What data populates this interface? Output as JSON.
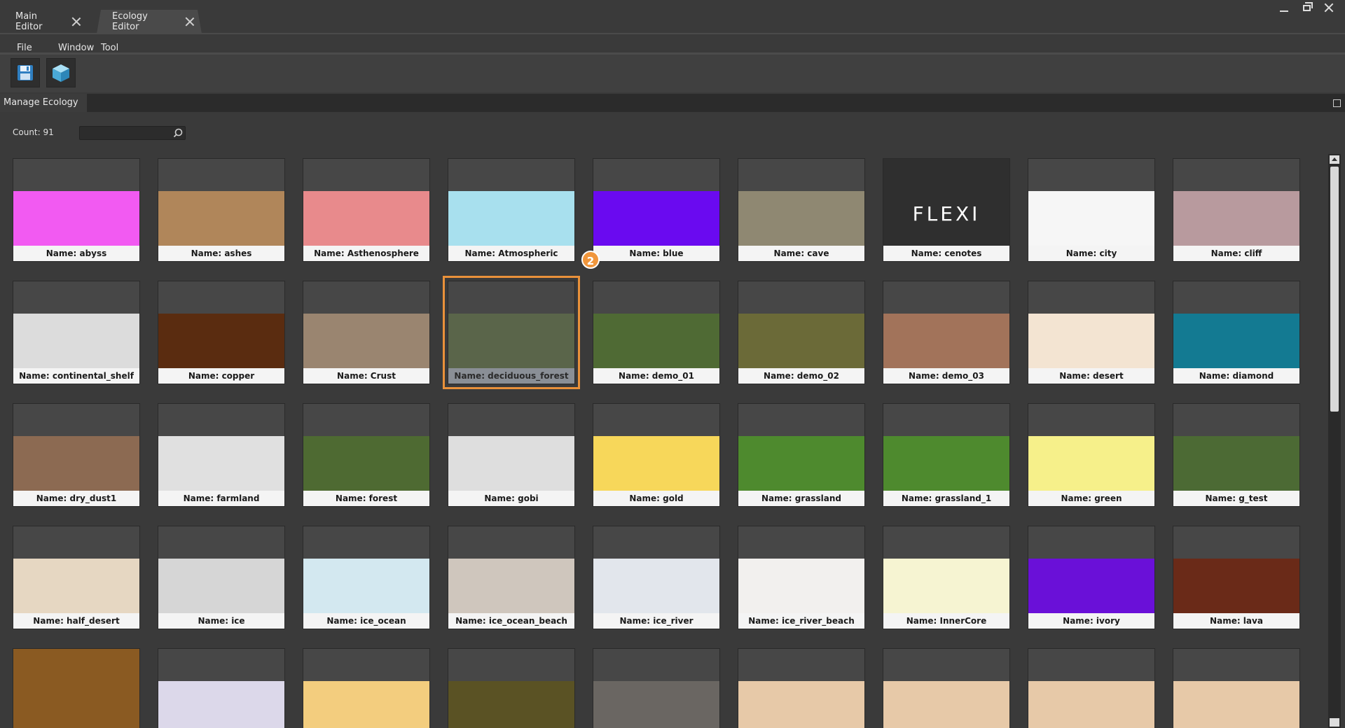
{
  "tabs": [
    {
      "label": "Main Editor"
    },
    {
      "label": "Ecology Editor"
    }
  ],
  "menu": {
    "file": "File",
    "window": "Window",
    "tool": "Tool"
  },
  "toolbar": {
    "save_icon": "save-disk-icon",
    "cube_icon": "cube-icon"
  },
  "panel": {
    "title": "Manage Ecology",
    "count_label": "Count: 91",
    "search_value": ""
  },
  "annotation": {
    "badge": "2"
  },
  "cards": [
    {
      "name": "Name: abyss",
      "color": "#f25af2",
      "sky": true
    },
    {
      "name": "Name: ashes",
      "color": "#b0865a",
      "sky": true
    },
    {
      "name": "Name: Asthenosphere",
      "color": "#e88a8c",
      "sky": true
    },
    {
      "name": "Name: Atmospheric",
      "color": "#a8e0ee",
      "sky": true
    },
    {
      "name": "Name: blue",
      "color": "#6a0af0",
      "sky": true
    },
    {
      "name": "Name: cave",
      "color": "#8f8872",
      "sky": true
    },
    {
      "name": "Name: cenotes",
      "color": "#2f2f2f",
      "sky": false,
      "logo": "FLEXI"
    },
    {
      "name": "Name: city",
      "color": "#f6f6f6",
      "sky": true
    },
    {
      "name": "Name: cliff",
      "color": "#b89a9e",
      "sky": true
    },
    {
      "name": "Name: continental_shelf",
      "color": "#dcdcdc",
      "sky": true
    },
    {
      "name": "Name: copper",
      "color": "#5a2c10",
      "sky": true
    },
    {
      "name": "Name: Crust",
      "color": "#9a8570",
      "sky": true
    },
    {
      "name": "Name: deciduous_forest",
      "color": "#5d6a4a",
      "sky": true,
      "selected": true
    },
    {
      "name": "Name: demo_01",
      "color": "#4f6a34",
      "sky": true
    },
    {
      "name": "Name: demo_02",
      "color": "#6b6a38",
      "sky": true
    },
    {
      "name": "Name: demo_03",
      "color": "#a2735a",
      "sky": true
    },
    {
      "name": "Name: desert",
      "color": "#f3e4d2",
      "sky": true
    },
    {
      "name": "Name: diamond",
      "color": "#137a92",
      "sky": true
    },
    {
      "name": "Name: dry_dust1",
      "color": "#8c6a52",
      "sky": true
    },
    {
      "name": "Name: farmland",
      "color": "#e0e0e0",
      "sky": true
    },
    {
      "name": "Name: forest",
      "color": "#4e6a32",
      "sky": true
    },
    {
      "name": "Name: gobi",
      "color": "#dedede",
      "sky": true
    },
    {
      "name": "Name: gold",
      "color": "#f7d75a",
      "sky": true
    },
    {
      "name": "Name: grassland",
      "color": "#4e8a2e",
      "sky": true
    },
    {
      "name": "Name: grassland_1",
      "color": "#4e8a2e",
      "sky": true
    },
    {
      "name": "Name: green",
      "color": "#f6f08a",
      "sky": true
    },
    {
      "name": "Name: g_test",
      "color": "#4c6a34",
      "sky": true
    },
    {
      "name": "Name: half_desert",
      "color": "#e6d7c2",
      "sky": true
    },
    {
      "name": "Name: ice",
      "color": "#d6d6d6",
      "sky": true
    },
    {
      "name": "Name: ice_ocean",
      "color": "#d3e8f0",
      "sky": true
    },
    {
      "name": "Name: ice_ocean_beach",
      "color": "#cfc6bd",
      "sky": true
    },
    {
      "name": "Name: ice_river",
      "color": "#e2e6ec",
      "sky": true
    },
    {
      "name": "Name: ice_river_beach",
      "color": "#f2f0ee",
      "sky": true
    },
    {
      "name": "Name: InnerCore",
      "color": "#f6f4d2",
      "sky": true
    },
    {
      "name": "Name: ivory",
      "color": "#6a10d8",
      "sky": true
    },
    {
      "name": "Name: lava",
      "color": "#6a2a18",
      "sky": true
    },
    {
      "name": "",
      "color": "#8a5a22",
      "sky": false
    },
    {
      "name": "",
      "color": "#dcd8ea",
      "sky": true
    },
    {
      "name": "",
      "color": "#f3cd7e",
      "sky": true
    },
    {
      "name": "",
      "color": "#5a5224",
      "sky": true
    },
    {
      "name": "",
      "color": "#6a6662",
      "sky": true
    },
    {
      "name": "",
      "color": "#e7c9a8",
      "sky": true
    },
    {
      "name": "",
      "color": "#e7c9a8",
      "sky": true
    },
    {
      "name": "",
      "color": "#e7c9a8",
      "sky": true
    },
    {
      "name": "",
      "color": "#e7c9a8",
      "sky": true
    }
  ]
}
